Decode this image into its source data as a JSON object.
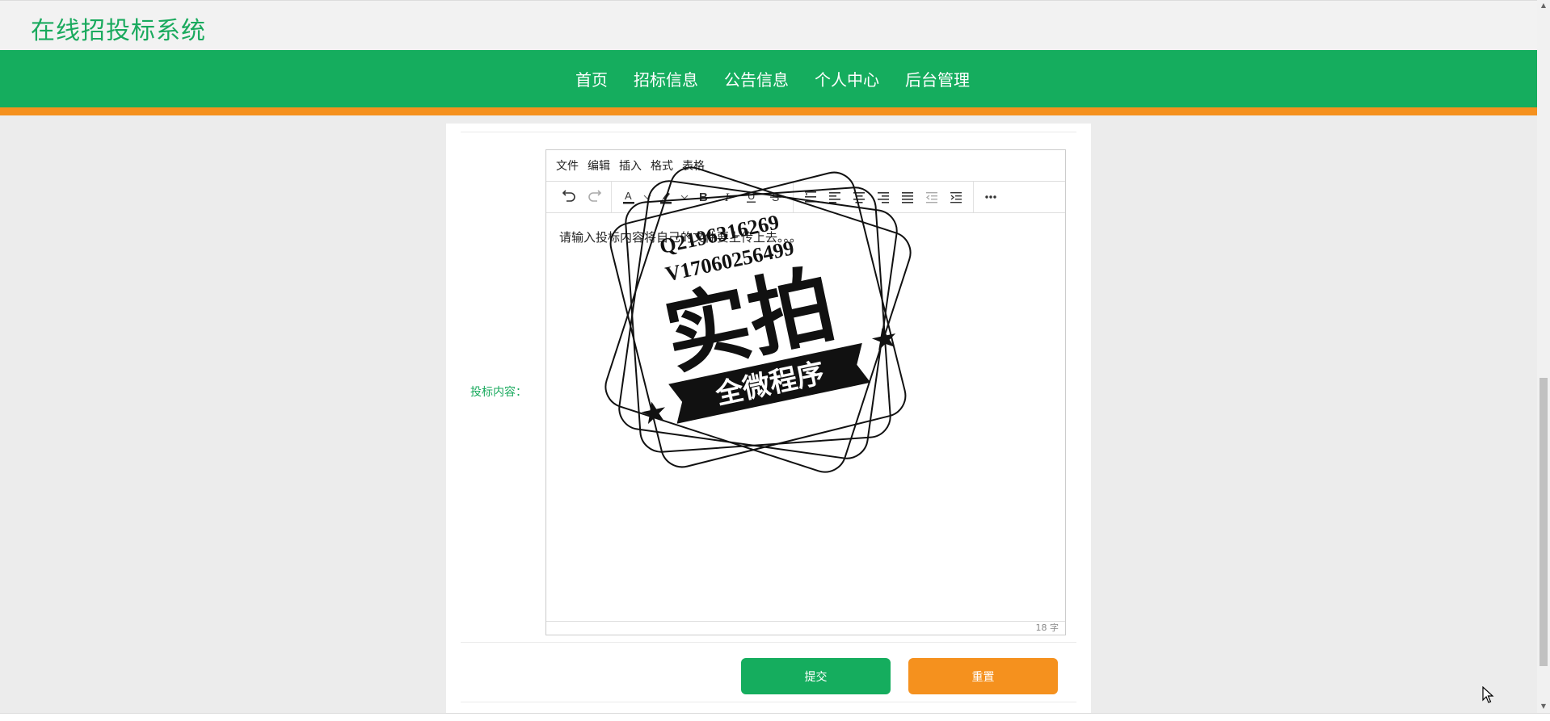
{
  "site": {
    "title": "在线招投标系统"
  },
  "nav": {
    "items": [
      {
        "label": "首页"
      },
      {
        "label": "招标信息"
      },
      {
        "label": "公告信息"
      },
      {
        "label": "个人中心"
      },
      {
        "label": "后台管理"
      }
    ]
  },
  "form": {
    "content_label": "投标内容：",
    "editor": {
      "menus": [
        "文件",
        "编辑",
        "插入",
        "格式",
        "表格"
      ],
      "toolbar_icons": [
        "undo-icon",
        "redo-icon",
        "text-color-icon",
        "highlight-icon",
        "bold-icon",
        "italic-icon",
        "underline-icon",
        "strikethrough-icon",
        "line-height-icon",
        "align-left-icon",
        "align-center-icon",
        "align-right-icon",
        "align-justify-icon",
        "outdent-icon",
        "indent-icon",
        "more-icon"
      ],
      "body_text": "请输入投标内容将自己的文件要上传上去。。。",
      "word_count": "18 字"
    },
    "submit_label": "提交",
    "reset_label": "重置"
  },
  "watermark": {
    "line1": "Q2196316269",
    "line2": "V17060256499",
    "main": "实拍",
    "banner": "全微程序"
  },
  "colors": {
    "brand_green": "#15ad5e",
    "accent_orange": "#f5911e",
    "label_green": "#1aaa5e"
  }
}
